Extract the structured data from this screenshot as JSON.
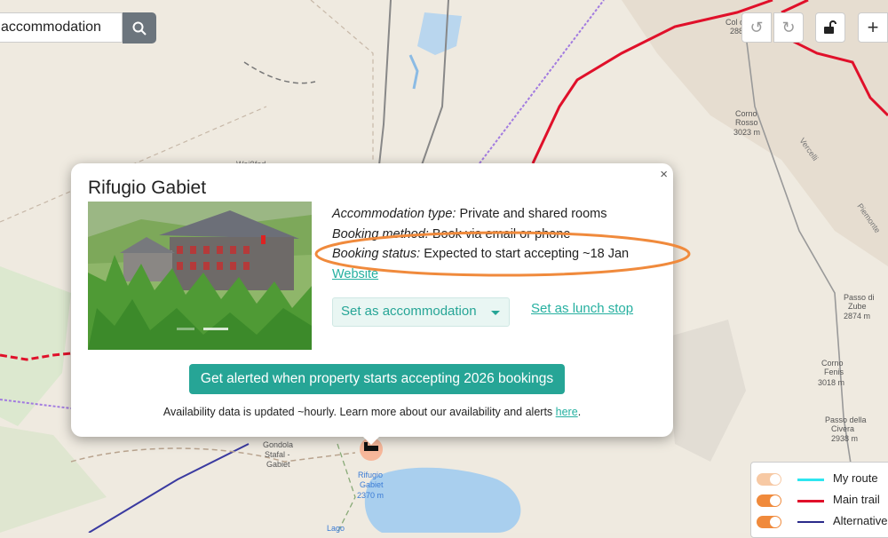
{
  "search": {
    "value": "accommodation"
  },
  "map_labels": {
    "weissfed": "Weißfed",
    "col": "Col d'Olen",
    "col_alt": "2881 m",
    "corno_rosso": "Corno",
    "corno_rosso2": "Rosso",
    "corno_rosso_alt": "3023 m",
    "passo_zube": "Passo di",
    "passo_zube2": "Zube",
    "passo_zube_alt": "2874 m",
    "corno_fenis": "Corno",
    "corno_fenis2": "Fenis",
    "corno_fenis_alt": "3018 m",
    "passo_civera": "Passo della",
    "passo_civera2": "Civera",
    "passo_civera_alt": "2938 m",
    "gondola": "Gondola",
    "gondola2": "Stafal -",
    "gondola3": "Gabiet",
    "rifugio": "Rifugio",
    "rifugio2": "Gabiet",
    "rifugio_alt": "2370 m",
    "lago": "Lago",
    "piemonte": "Piemonte",
    "vercelli": "Vercelli"
  },
  "popup": {
    "title": "Rifugio Gabiet",
    "close": "×",
    "type_label": "Accommodation type:",
    "type_value": "Private and shared rooms",
    "method_label": "Booking method:",
    "method_value": "Book via email or phone",
    "status_label": "Booking status:",
    "status_value": "Expected to start accepting ~18 Jan",
    "website": "Website",
    "select_value": "Set as accommodation",
    "lunch_link": "Set as lunch stop",
    "alert_button": "Get alerted when property starts accepting 2026 bookings",
    "footnote_text": "Availability data is updated ~hourly. Learn more about our availability and alerts ",
    "footnote_link": "here",
    "footnote_end": "."
  },
  "legend": [
    {
      "label": "My route",
      "color": "#2ee6f0",
      "toggle": "#f7c9a4"
    },
    {
      "label": "Main trail",
      "color": "#e0102a",
      "toggle": "#f08a3c"
    },
    {
      "label": "Alternative",
      "color": "#2a2a8a",
      "toggle": "#f08a3c"
    }
  ],
  "colors": {
    "accent": "#26a596",
    "annotation": "#f08a3c",
    "main_trail": "#e0102a"
  }
}
